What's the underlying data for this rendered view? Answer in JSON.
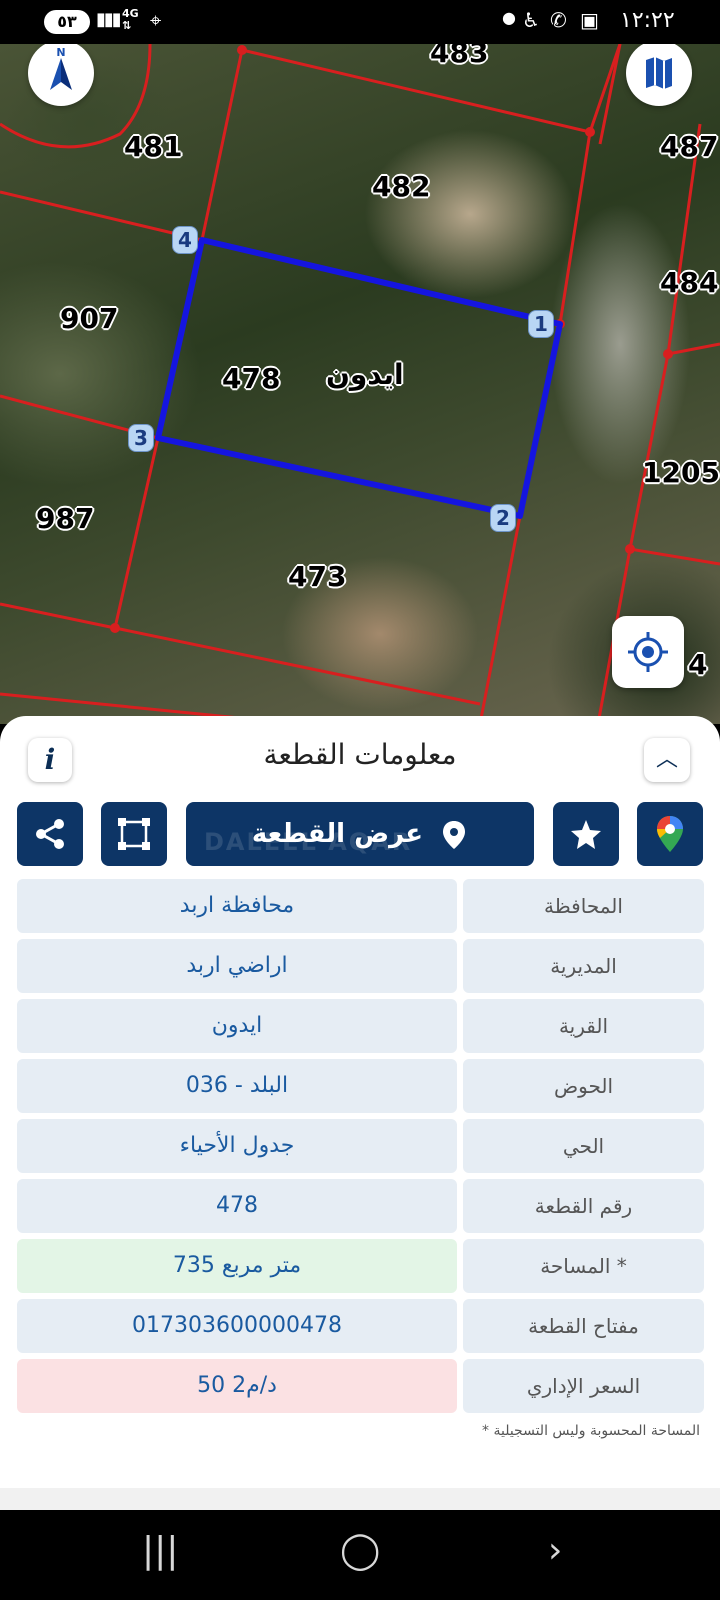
{
  "status_bar": {
    "battery": "٥٣",
    "network": "4G",
    "time": "١٢:٢٢"
  },
  "map": {
    "parcel_labels": {
      "p483": "483",
      "p481": "481",
      "p482": "482",
      "p487": "487",
      "p484": "484",
      "p907": "907",
      "p478": "478",
      "village": "ايدون",
      "p1205": "1205",
      "p987": "987",
      "p473": "473"
    },
    "vertex_labels": [
      "1",
      "2",
      "3",
      "4"
    ],
    "edge_char": "4",
    "colors": {
      "parcel_outline": "#1515e0",
      "boundary_lines": "#d81f1f"
    }
  },
  "sheet": {
    "title": "معلومات القطعة",
    "show_parcel_label": "عرض القطعة",
    "watermark": "DALEEL AQAR",
    "rows": [
      {
        "key": "المحافظة",
        "value": "محافظة اربد",
        "tone": "blue"
      },
      {
        "key": "المديرية",
        "value": "اراضي اربد",
        "tone": "blue"
      },
      {
        "key": "القرية",
        "value": "ايدون",
        "tone": "blue"
      },
      {
        "key": "الحوض",
        "value": "البلد - 036",
        "tone": "blue"
      },
      {
        "key": "الحي",
        "value": "جدول الأحياء",
        "tone": "blue"
      },
      {
        "key": "رقم القطعة",
        "value": "478",
        "tone": "blue"
      },
      {
        "key": "المساحة *",
        "value": "735  متر مربع",
        "tone": "green"
      },
      {
        "key": "مفتاح القطعة",
        "value": "017303600000478",
        "tone": "blue"
      },
      {
        "key": "السعر الإداري",
        "value": "50 د/م2",
        "tone": "red"
      }
    ],
    "note": "* المساحة المحسوبة وليس التسجيلية"
  },
  "colors": {
    "primary": "#0d3566",
    "row_blue": "#e6edf4",
    "row_green": "#e3f5e6",
    "row_red": "#fbe1e3",
    "value_text": "#1a5aa0"
  }
}
